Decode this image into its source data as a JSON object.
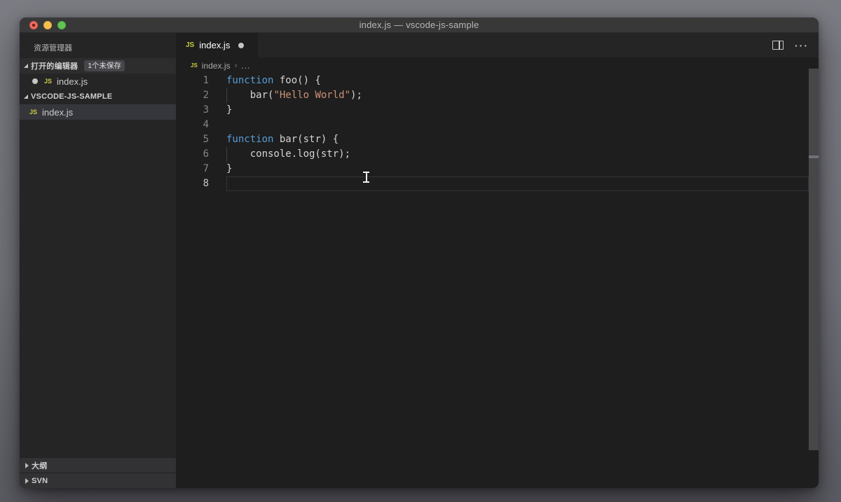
{
  "window": {
    "title": "index.js — vscode-js-sample"
  },
  "icons": {
    "js_badge": "JS"
  },
  "sidebar": {
    "title": "资源管理器",
    "open_editors": {
      "label": "打开的编辑器",
      "badge": "1个未保存",
      "items": [
        {
          "name": "index.js",
          "modified": true
        }
      ]
    },
    "folder": {
      "label": "VSCODE-JS-SAMPLE",
      "items": [
        {
          "name": "index.js",
          "selected": true
        }
      ]
    },
    "bottom_sections": [
      {
        "label": "大纲"
      },
      {
        "label": "SVN"
      }
    ]
  },
  "editor": {
    "tab": {
      "label": "index.js",
      "modified": true
    },
    "actions": {
      "more_label": "···"
    },
    "breadcrumb": {
      "file": "index.js",
      "separator": "›",
      "tail": "..."
    },
    "code": {
      "language": "javascript",
      "lines": [
        {
          "num": 1,
          "tokens": [
            {
              "c": "keyword",
              "t": "function"
            },
            {
              "c": "plain",
              "t": " foo() {"
            }
          ]
        },
        {
          "num": 2,
          "indent": true,
          "tokens": [
            {
              "c": "plain",
              "t": "    bar("
            },
            {
              "c": "string",
              "t": "\"Hello World\""
            },
            {
              "c": "plain",
              "t": ");"
            }
          ]
        },
        {
          "num": 3,
          "tokens": [
            {
              "c": "plain",
              "t": "}"
            }
          ]
        },
        {
          "num": 4,
          "tokens": []
        },
        {
          "num": 5,
          "tokens": [
            {
              "c": "keyword",
              "t": "function"
            },
            {
              "c": "plain",
              "t": " bar(str) {"
            }
          ]
        },
        {
          "num": 6,
          "indent": true,
          "tokens": [
            {
              "c": "plain",
              "t": "    console.log(str);"
            }
          ]
        },
        {
          "num": 7,
          "tokens": [
            {
              "c": "plain",
              "t": "}"
            }
          ]
        },
        {
          "num": 8,
          "active": true,
          "tokens": []
        }
      ]
    }
  },
  "colors": {
    "keyword": "#569cd6",
    "string": "#ce9178",
    "plain": "#d4d4d4",
    "editor_bg": "#1e1e1e",
    "sidebar_bg": "#252526",
    "js_icon": "#cbcb41"
  }
}
